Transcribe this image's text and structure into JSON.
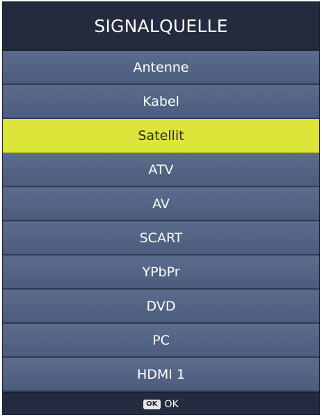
{
  "menu": {
    "title": "SIGNALQUELLE",
    "selected_index": 2,
    "items": [
      {
        "label": "Antenne"
      },
      {
        "label": "Kabel"
      },
      {
        "label": "Satellit"
      },
      {
        "label": "ATV"
      },
      {
        "label": "AV"
      },
      {
        "label": "SCART"
      },
      {
        "label": "YPbPr"
      },
      {
        "label": "DVD"
      },
      {
        "label": "PC"
      },
      {
        "label": "HDMI 1"
      }
    ]
  },
  "footer": {
    "ok_key": "OK",
    "ok_label": "OK"
  },
  "colors": {
    "panel_background": "#4a5a79",
    "title_background": "#232b3f",
    "highlight": "#dde53a"
  },
  "icons": {
    "ok_key": "ok-key-icon"
  }
}
